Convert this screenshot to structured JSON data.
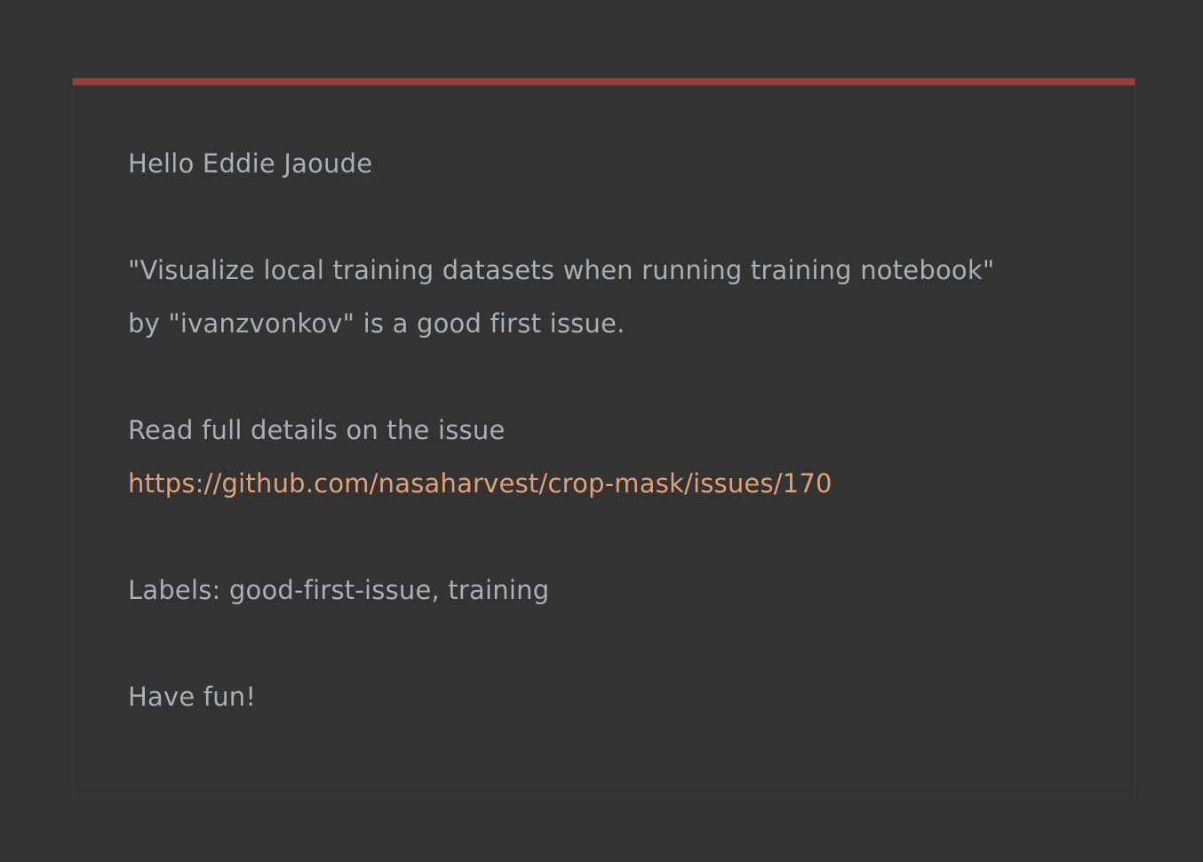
{
  "email": {
    "greeting": "Hello Eddie Jaoude",
    "issue_line_1": "\"Visualize local training datasets when running training notebook\"",
    "issue_line_2": "by \"ivanzvonkov\" is a good first issue.",
    "details_label": "Read full details on the issue",
    "issue_url": "https://github.com/nasaharvest/crop-mask/issues/170",
    "labels_text": "Labels: good-first-issue, training",
    "closing": "Have fun!"
  },
  "colors": {
    "background": "#333333",
    "text": "#a6b0b8",
    "link": "#e0a07a",
    "accent": "#963f3a"
  }
}
